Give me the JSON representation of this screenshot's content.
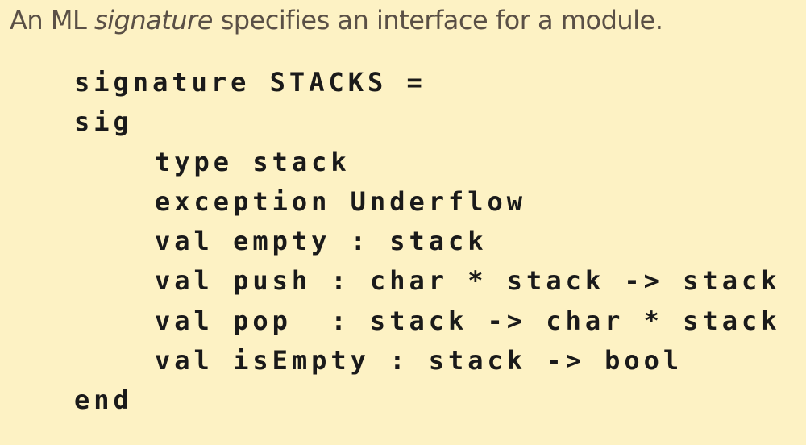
{
  "intro": {
    "prefix": "An ML ",
    "emphasis": "signature",
    "suffix": " specifies an interface for a module."
  },
  "code": {
    "lines": [
      "signature STACKS =",
      "sig",
      "type stack",
      "exception Underflow",
      "val empty : stack",
      "val push : char * stack -> stack",
      "val pop  : stack -> char * stack",
      "val isEmpty : stack -> bool",
      "end"
    ]
  }
}
